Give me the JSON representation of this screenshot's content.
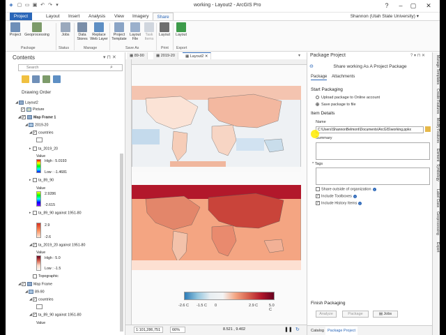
{
  "window": {
    "title": "working - Layout2 - ArcGIS Pro",
    "user": "Shannon (Utah State University)"
  },
  "ribbon_tabs": [
    "Project",
    "Layout",
    "Insert",
    "Analysis",
    "View",
    "Imagery",
    "Share"
  ],
  "ribbon": {
    "buttons": [
      {
        "label": "Project",
        "icon": "project-package-icon"
      },
      {
        "label": "Geoprocessing",
        "icon": "geoprocessing-package-icon"
      },
      {
        "label": "Jobs",
        "icon": "jobs-icon"
      },
      {
        "label": "Data Stores",
        "icon": "data-stores-icon"
      },
      {
        "label": "Replace Web Layer",
        "icon": "replace-web-layer-icon"
      },
      {
        "label": "Project Template",
        "icon": "project-template-icon"
      },
      {
        "label": "Layout File",
        "icon": "layout-file-icon"
      },
      {
        "label": "Task Items",
        "icon": "task-items-icon"
      },
      {
        "label": "Layout",
        "icon": "print-layout-icon"
      },
      {
        "label": "Layout",
        "icon": "export-layout-icon"
      }
    ],
    "groups": [
      "Package",
      "Status",
      "Manage",
      "Save As",
      "Print",
      "Export"
    ]
  },
  "contents": {
    "title": "Contents",
    "search_placeholder": "Search",
    "drawing_order": "Drawing Order",
    "items": [
      {
        "label": "Layout2",
        "checked": null
      },
      {
        "label": "Picture",
        "checked": true
      },
      {
        "label": "Map Frame 1",
        "checked": true
      },
      {
        "label": "2019-20",
        "checked": null
      },
      {
        "label": "countries",
        "checked": true
      },
      {
        "label": "ta_2019_20",
        "checked": false
      },
      {
        "label": "Value",
        "checked": null
      },
      {
        "label": "High : 5.0193",
        "checked": null
      },
      {
        "label": "Low : -1.4681",
        "checked": null
      },
      {
        "label": "ta_89_90",
        "checked": false
      },
      {
        "label": "Value",
        "checked": null
      },
      {
        "label": "2.9286",
        "checked": null
      },
      {
        "label": "-2.615",
        "checked": null
      },
      {
        "label": "ta_89_90 against 1951-80",
        "checked": false
      },
      {
        "label": "2.9",
        "checked": null
      },
      {
        "label": "-2.6",
        "checked": null
      },
      {
        "label": "ta_2019_20 against 1951-80",
        "checked": true
      },
      {
        "label": "Value",
        "checked": null
      },
      {
        "label": "High : 5.0",
        "checked": null
      },
      {
        "label": "Low : -1.5",
        "checked": null
      },
      {
        "label": "Topographic",
        "checked": false
      },
      {
        "label": "Map Frame",
        "checked": true
      },
      {
        "label": "89-90",
        "checked": null
      },
      {
        "label": "countries",
        "checked": true
      },
      {
        "label": "ta_89_90 against 1951-80",
        "checked": true
      },
      {
        "label": "Value",
        "checked": null
      }
    ]
  },
  "view_tabs": [
    "89-90",
    "2019-20",
    "Layout2"
  ],
  "legend": {
    "labels": [
      "-2.6 C",
      "-1.5 C",
      "0",
      "2.9 C",
      "5.0 C"
    ]
  },
  "status": {
    "scale": "1:101,286,751",
    "zoom": "66%",
    "coords": "8.521 , 9.402"
  },
  "package": {
    "title": "Package Project",
    "subtitle": "Share working As A Project Package",
    "tabs": [
      "Package",
      "Attachments"
    ],
    "start": "Start Packaging",
    "upload": "Upload package to Online account",
    "save": "Save package to file",
    "item_details": "Item Details",
    "name_label": "Name",
    "name_value": "C:\\Users\\ShannonBelmont\\Documents\\ArcGIS\\working.ppkx",
    "summary_label": "Summary",
    "tags_label": "* Tags",
    "share_outside": "Share outside of organization",
    "include_toolboxes": "Include Toolboxes",
    "include_history": "Include History Items",
    "finish": "Finish Packaging",
    "analyze": "Analyze",
    "package_btn": "Package",
    "jobs_btn": "Jobs",
    "bottom_tabs": [
      "Catalog",
      "Package Project"
    ]
  },
  "side_tabs": [
    "Manage Templates",
    "Create Features",
    "Modify Features",
    "Element",
    "Symbology",
    "Label Class",
    "Geoprocessing",
    "Export"
  ]
}
